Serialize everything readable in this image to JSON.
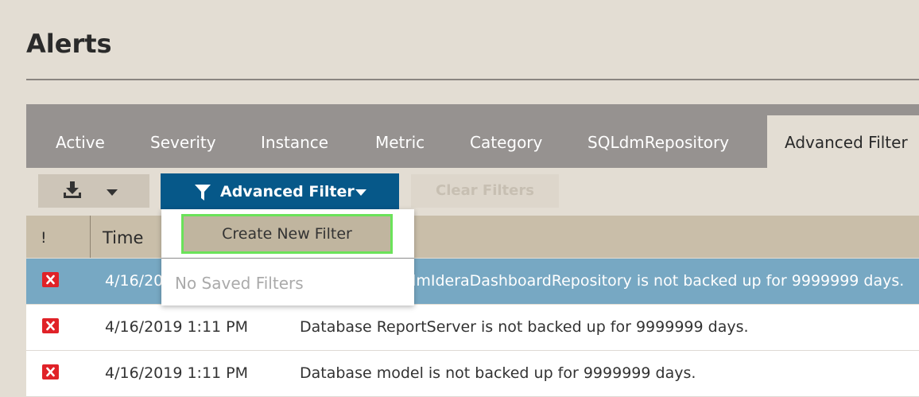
{
  "page": {
    "title": "Alerts"
  },
  "tabs": {
    "items": [
      {
        "label": "Active"
      },
      {
        "label": "Severity"
      },
      {
        "label": "Instance"
      },
      {
        "label": "Metric"
      },
      {
        "label": "Category"
      },
      {
        "label": "SQLdmRepository"
      }
    ],
    "active_label": "Advanced Filter"
  },
  "toolbar": {
    "export_icon": "download-icon",
    "export_caret_icon": "caret-down-icon",
    "advanced_filter_label": "Advanced Filter",
    "advanced_filter_icon": "filter-funnel-icon",
    "advanced_filter_caret_icon": "caret-down-icon",
    "clear_filters_label": "Clear Filters",
    "clear_filters_enabled": false
  },
  "grid": {
    "columns": {
      "severity": "!",
      "time": "Time"
    },
    "rows": [
      {
        "severity_icon": "error-x-icon",
        "time": "4/16/2019 1:11 PM",
        "message": "Database SQLdmIderaDashboardRepository is not backed up for 9999999 days.",
        "selected": true
      },
      {
        "severity_icon": "error-x-icon",
        "time": "4/16/2019 1:11 PM",
        "message": "Database ReportServer is not backed up for 9999999 days.",
        "selected": false
      },
      {
        "severity_icon": "error-x-icon",
        "time": "4/16/2019 1:11 PM",
        "message": "Database model is not backed up for 9999999 days.",
        "selected": false
      }
    ]
  },
  "dropdown": {
    "create_label": "Create New Filter",
    "empty_label": "No Saved Filters"
  },
  "colors": {
    "page_background": "#e3ddd3",
    "tab_bar": "#969290",
    "primary_button": "#065889",
    "grid_header": "#c9bea9",
    "selected_row": "#77a8c3",
    "error_icon": "#e02228",
    "focus_outline": "#6be25a"
  }
}
